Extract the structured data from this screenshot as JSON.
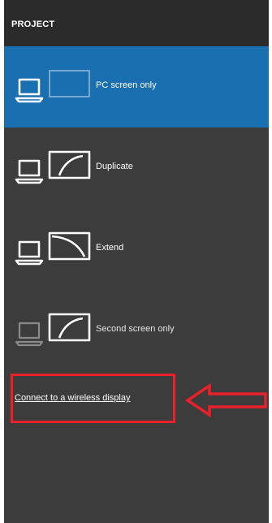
{
  "panel": {
    "title": "PROJECT"
  },
  "options": [
    {
      "label": "PC screen only",
      "icon": "pc-screen-only-icon",
      "selected": true
    },
    {
      "label": "Duplicate",
      "icon": "duplicate-icon",
      "selected": false
    },
    {
      "label": "Extend",
      "icon": "extend-icon",
      "selected": false
    },
    {
      "label": "Second screen only",
      "icon": "second-screen-only-icon",
      "selected": false
    }
  ],
  "wireless_link": {
    "label": "Connect to a wireless display"
  },
  "colors": {
    "panel_background": "#3c3c3c",
    "header_background": "#2b2b2b",
    "selected_accent": "#1a6fb0",
    "annotation_red": "#e8202a"
  }
}
